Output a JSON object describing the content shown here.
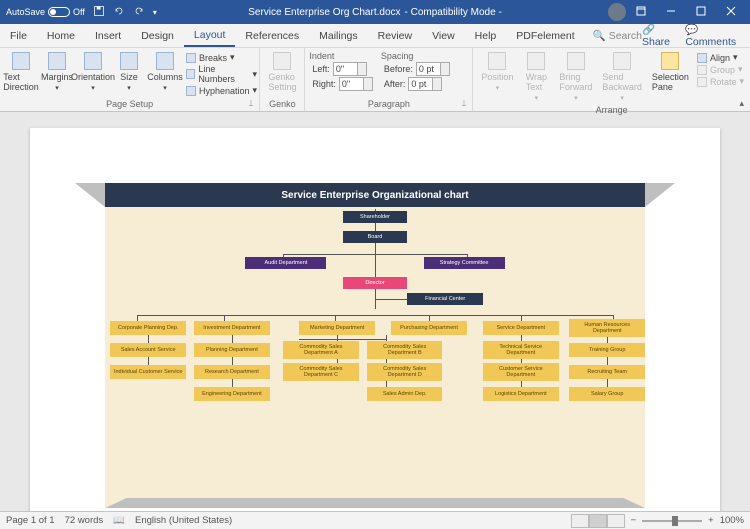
{
  "titlebar": {
    "autosave_label": "AutoSave",
    "autosave_state": "Off",
    "doc_name": "Service Enterprise Org Chart.docx",
    "mode": "Compatibility Mode"
  },
  "tabs": {
    "file": "File",
    "home": "Home",
    "insert": "Insert",
    "design": "Design",
    "layout": "Layout",
    "references": "References",
    "mailings": "Mailings",
    "review": "Review",
    "view": "View",
    "help": "Help",
    "pdfelement": "PDFelement",
    "search": "Search",
    "share": "Share",
    "comments": "Comments"
  },
  "ribbon": {
    "page_setup": {
      "label": "Page Setup",
      "text_direction": "Text\nDirection",
      "margins": "Margins",
      "orientation": "Orientation",
      "size": "Size",
      "columns": "Columns",
      "breaks": "Breaks",
      "line_numbers": "Line Numbers",
      "hyphenation": "Hyphenation"
    },
    "genko": {
      "label": "Genko",
      "setting": "Genko\nSetting"
    },
    "paragraph": {
      "label": "Paragraph",
      "indent": "Indent",
      "spacing": "Spacing",
      "left": "Left:",
      "right": "Right:",
      "before": "Before:",
      "after": "After:",
      "left_val": "0\"",
      "right_val": "0\"",
      "before_val": "0 pt",
      "after_val": "0 pt"
    },
    "arrange": {
      "label": "Arrange",
      "position": "Position",
      "wrap_text": "Wrap\nText",
      "bring_forward": "Bring\nForward",
      "send_backward": "Send\nBackward",
      "selection_pane": "Selection\nPane",
      "align": "Align",
      "group": "Group",
      "rotate": "Rotate"
    }
  },
  "chart": {
    "title": "Service Enterprise Organizational chart",
    "nodes": {
      "shareholder": "Shareholder",
      "board": "Board",
      "audit": "Audit Department",
      "strategy": "Strategy Committee",
      "director": "Director",
      "financial": "Financial Center",
      "corp_plan": "Corporate Planning Dep.",
      "investment": "Investment Department",
      "marketing": "Marketing Department",
      "purchasing": "Purchasing Department",
      "service": "Service Department",
      "hr": "Human Resources Department",
      "sales_acct": "Sales Account Service",
      "planning": "Planning Department",
      "comm_a": "Commodity Sales Department A",
      "comm_b": "Commodity Sales Department B",
      "tech_svc": "Technical Service Department",
      "training": "Training Group",
      "indiv_cust": "Individual Customer Service",
      "research": "Research Department",
      "comm_c": "Commodity Sales Department C",
      "comm_d": "Commodity Sales Department D",
      "cust_svc": "Customer Service Department",
      "recruiting": "Recruiting Team",
      "engineering": "Engineering Department",
      "sales_admin": "Sales Admin Dep.",
      "logistics": "Logistics Department",
      "salary": "Salary Group"
    }
  },
  "status": {
    "page": "Page 1 of 1",
    "words": "72 words",
    "lang": "English (United States)",
    "zoom": "100%"
  }
}
